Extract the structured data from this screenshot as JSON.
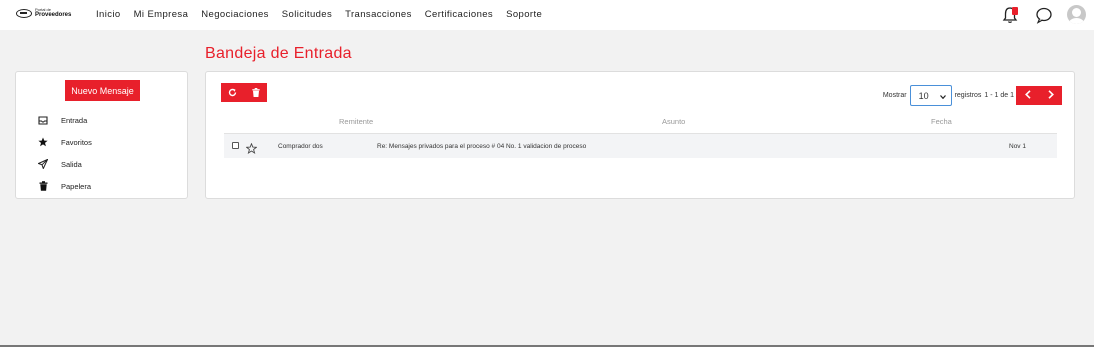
{
  "header": {
    "logo_small": "Portal de",
    "logo_big": "Proveedores",
    "nav": [
      "Inicio",
      "Mi Empresa",
      "Negociaciones",
      "Solicitudes",
      "Transacciones",
      "Certificaciones",
      "Soporte"
    ]
  },
  "page": {
    "title": "Bandeja de Entrada"
  },
  "sidebar": {
    "new_message": "Nuevo Mensaje",
    "items": [
      {
        "label": "Entrada",
        "icon": "inbox-icon"
      },
      {
        "label": "Favoritos",
        "icon": "star-icon"
      },
      {
        "label": "Salida",
        "icon": "send-icon"
      },
      {
        "label": "Papelera",
        "icon": "trash-icon"
      }
    ]
  },
  "toolbar": {
    "show_label": "Mostrar",
    "page_size": "10",
    "records_label": "registros",
    "range": "1 - 1 de 1"
  },
  "table": {
    "columns": [
      "Remitente",
      "Asunto",
      "Fecha"
    ],
    "rows": [
      {
        "sender": "Comprador dos",
        "subject": "Re: Mensajes privados para el proceso # 04 No. 1 validacion de proceso",
        "date": "Nov 1"
      }
    ]
  },
  "colors": {
    "accent": "#e8202b"
  }
}
